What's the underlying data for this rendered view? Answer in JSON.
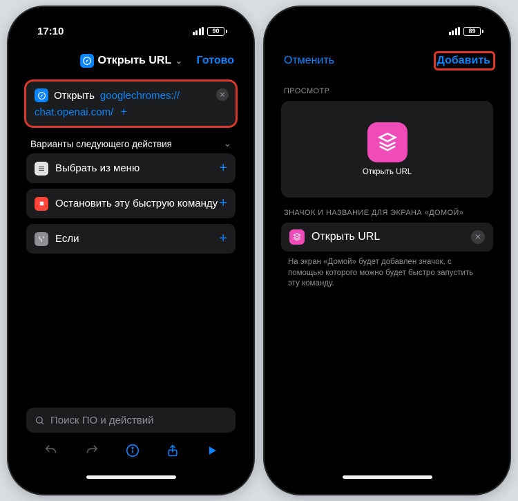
{
  "phone1": {
    "status": {
      "time": "17:10",
      "battery": "90"
    },
    "nav": {
      "title": "Открыть URL",
      "done": "Готово"
    },
    "action_card": {
      "verb": "Открыть",
      "url_part1": "googlechromes://",
      "url_part2": "chat.openai.com/",
      "plus": "+"
    },
    "suggestions_title": "Варианты следующего действия",
    "suggestions": [
      {
        "label": "Выбрать из меню"
      },
      {
        "label": "Остановить эту быструю команду"
      },
      {
        "label": "Если"
      }
    ],
    "search_placeholder": "Поиск ПО и действий"
  },
  "phone2": {
    "status": {
      "battery": "89"
    },
    "nav": {
      "cancel": "Отменить",
      "add": "Добавить"
    },
    "preview_caption": "ПРОСМОТР",
    "preview_label": "Открыть URL",
    "section2_caption": "ЗНАЧОК И НАЗВАНИЕ ДЛЯ ЭКРАНА «ДОМОЙ»",
    "name_value": "Открыть URL",
    "help_text": "На экран «Домой» будет добавлен значок, с помощью которого можно будет быстро запустить эту команду."
  }
}
